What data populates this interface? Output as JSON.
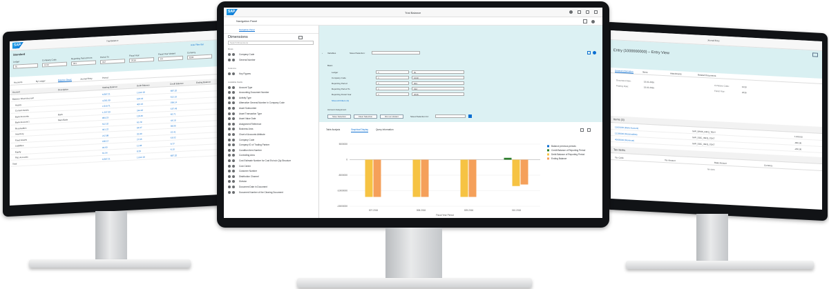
{
  "center": {
    "window_title": "Trial Balance",
    "panel_title": "Navigation Panel",
    "nav_tab": "Navigation Panel",
    "dimensions_title": "Dimensions",
    "search_placeholder": "Search Dimensions",
    "rows_label": "Rows",
    "columns_label": "Columns",
    "available_label": "Available Fields",
    "dimensions": [
      "Company Code",
      "General Number",
      "Key Figures",
      "Account Type",
      "Accounting Document Number",
      "Activity Type",
      "Alternative General Number in Company Code",
      "Asset Subnumber",
      "Asset Transaction Type",
      "Asset Value Date",
      "Assignment Reference",
      "Business Area",
      "Chart of Accounts Attribute",
      "Company Code",
      "Company ID of Trading Partner",
      "Condition Item Number",
      "Controlling Area",
      "Cost Estimate Number for Cost Est w/o Qty Structure",
      "Cost Center",
      "Customer Number",
      "Distribution Channel",
      "Division",
      "Document Date in Document",
      "Document Number of the Clearing Document"
    ],
    "variables_label": "Variables",
    "saved_selection": "Saved Selection:",
    "basic_label": "Basic",
    "filters": [
      {
        "label": "Ledger",
        "op": "=",
        "value": "0L"
      },
      {
        "label": "Company Code",
        "op": "=",
        "value": "1010"
      },
      {
        "label": "Reporting Period",
        "op": "=",
        "value": "001"
      },
      {
        "label": "Reporting Period To",
        "op": "=",
        "value": "012"
      },
      {
        "label": "Reporting Fiscal Year",
        "op": "=",
        "value": "2016"
      }
    ],
    "show_all_link": "Show All Filters (3)",
    "account_assignment_label": "Account Assignment",
    "buttons": [
      "Save Selection",
      "Clear Selection",
      "Run as Variant"
    ],
    "saved_selection_for": "Saved Selection for:",
    "tabs": [
      "Table Analysis",
      "Graphical Display",
      "Query Information"
    ],
    "active_tab": 1,
    "x_label": "Fiscal Year Period"
  },
  "chart_data": {
    "type": "bar",
    "categories": [
      "007.2016",
      "008.2016",
      "009.2016",
      "010.2016"
    ],
    "y_ticks": [
      "5000000",
      "0",
      "-5000000",
      "-10000000",
      "-15000000"
    ],
    "ylim": [
      -15000000,
      5000000
    ],
    "series": [
      {
        "name": "Balance previous periods",
        "values": [
          0,
          0,
          0,
          0
        ]
      },
      {
        "name": "Credit Balance of Reporting Period",
        "values": [
          0,
          0,
          0,
          600000
        ]
      },
      {
        "name": "Debit Balance of Reporting Period",
        "values": [
          -12000000,
          -12000000,
          -12000000,
          -8500000
        ]
      },
      {
        "name": "Ending Balance",
        "values": [
          -12000000,
          -12000000,
          -12000000,
          -8000000
        ]
      }
    ],
    "colors": [
      "#0a6ed1",
      "#2b7d2b",
      "#f6c343",
      "#f5a05a"
    ],
    "legend": "right",
    "xlabel": "Fiscal Year Period"
  },
  "left": {
    "window_title": "Trial Balance",
    "link": "Hide Filter Bar",
    "standard_label": "Standard",
    "filter_labels": [
      "Ledger",
      "Company Code",
      "Reporting Period From",
      "Period To",
      "Fiscal Year",
      "Fiscal Year Variant",
      "Currency"
    ],
    "filter_values": [
      "0L",
      "1010",
      "001",
      "012",
      "2016",
      "K4",
      "EUR"
    ],
    "tabs": [
      "Accounts",
      "By Ledger",
      "Balance Sheet",
      "Journal Entry",
      "Period"
    ],
    "columns": [
      "Account",
      "Description",
      "Starting Balance",
      "Debit Balance",
      "Credit Balance",
      "Ending Balance"
    ],
    "rows": [
      {
        "a": "Balance Sheet Account",
        "d": "",
        "v1": "6,587.21",
        "v2": "1,042.18",
        "v3": "-887.32"
      },
      {
        "a": "Assets",
        "d": "",
        "v1": "4,281.09",
        "v2": "618.44",
        "v3": "-512.10"
      },
      {
        "a": "Current Assets",
        "d": "",
        "v1": "2,319.71",
        "v2": "402.16",
        "v3": "-299.14"
      },
      {
        "a": "Bank Accounts",
        "d": "Bank",
        "v1": "1,207.33",
        "v2": "244.02",
        "v3": "-187.43"
      },
      {
        "a": "Bank Account 1",
        "d": "Main Bank",
        "v1": "884.15",
        "v2": "119.40",
        "v3": "-92.71"
      },
      {
        "a": "Receivables",
        "d": "",
        "v1": "512.02",
        "v2": "61.29",
        "v3": "-44.18"
      },
      {
        "a": "Inventory",
        "d": "",
        "v1": "301.22",
        "v2": "54.07",
        "v3": "-38.55"
      },
      {
        "a": "Fixed Assets",
        "d": "",
        "v1": "212.88",
        "v2": "31.90",
        "v3": "-22.41"
      },
      {
        "a": "Liabilities",
        "d": "",
        "v1": "188.12",
        "v2": "27.55",
        "v3": "-18.02"
      },
      {
        "a": "Equity",
        "d": "",
        "v1": "94.60",
        "v2": "11.83",
        "v3": "-9.77"
      },
      {
        "a": "P&L Accounts",
        "d": "",
        "v1": "61.04",
        "v2": "8.29",
        "v3": "-6.10"
      },
      {
        "a": "Total",
        "d": "",
        "v1": "6,587.21",
        "v2": "1,042.18",
        "v3": "-887.32"
      }
    ]
  },
  "right": {
    "window_title": "Journal Entry",
    "heading": "Entry (1000000000) – Entry View",
    "tabs": [
      "General Information",
      "Items",
      "Attachments",
      "Related Documents"
    ],
    "fields": [
      {
        "label": "Document Date:",
        "value": "15.01.2016"
      },
      {
        "label": "Posting Date:",
        "value": "15.01.2016"
      },
      {
        "label": "Company Code:",
        "value": "1010"
      },
      {
        "label": "Fiscal Year:",
        "value": "2016"
      }
    ],
    "items_title": "Items (3)",
    "item_rows": [
      {
        "gl": "11001000 (Bank Account)",
        "text": "SAP_BANK_INFO_TEXT",
        "amount": "1,000.00"
      },
      {
        "gl": "12100000 (Receivables)",
        "text": "SAP_DOC_INFO_TEXT",
        "amount": "-800.00"
      },
      {
        "gl": "40000000 (Revenue)",
        "text": "SAP_DOC_INFO_TEXT",
        "amount": "-200.00"
      }
    ],
    "tax_title": "Tax Items",
    "tax_columns": [
      "Tax Code",
      "Tax Amount",
      "Base Amount",
      "Currency"
    ],
    "no_data": "No data"
  }
}
